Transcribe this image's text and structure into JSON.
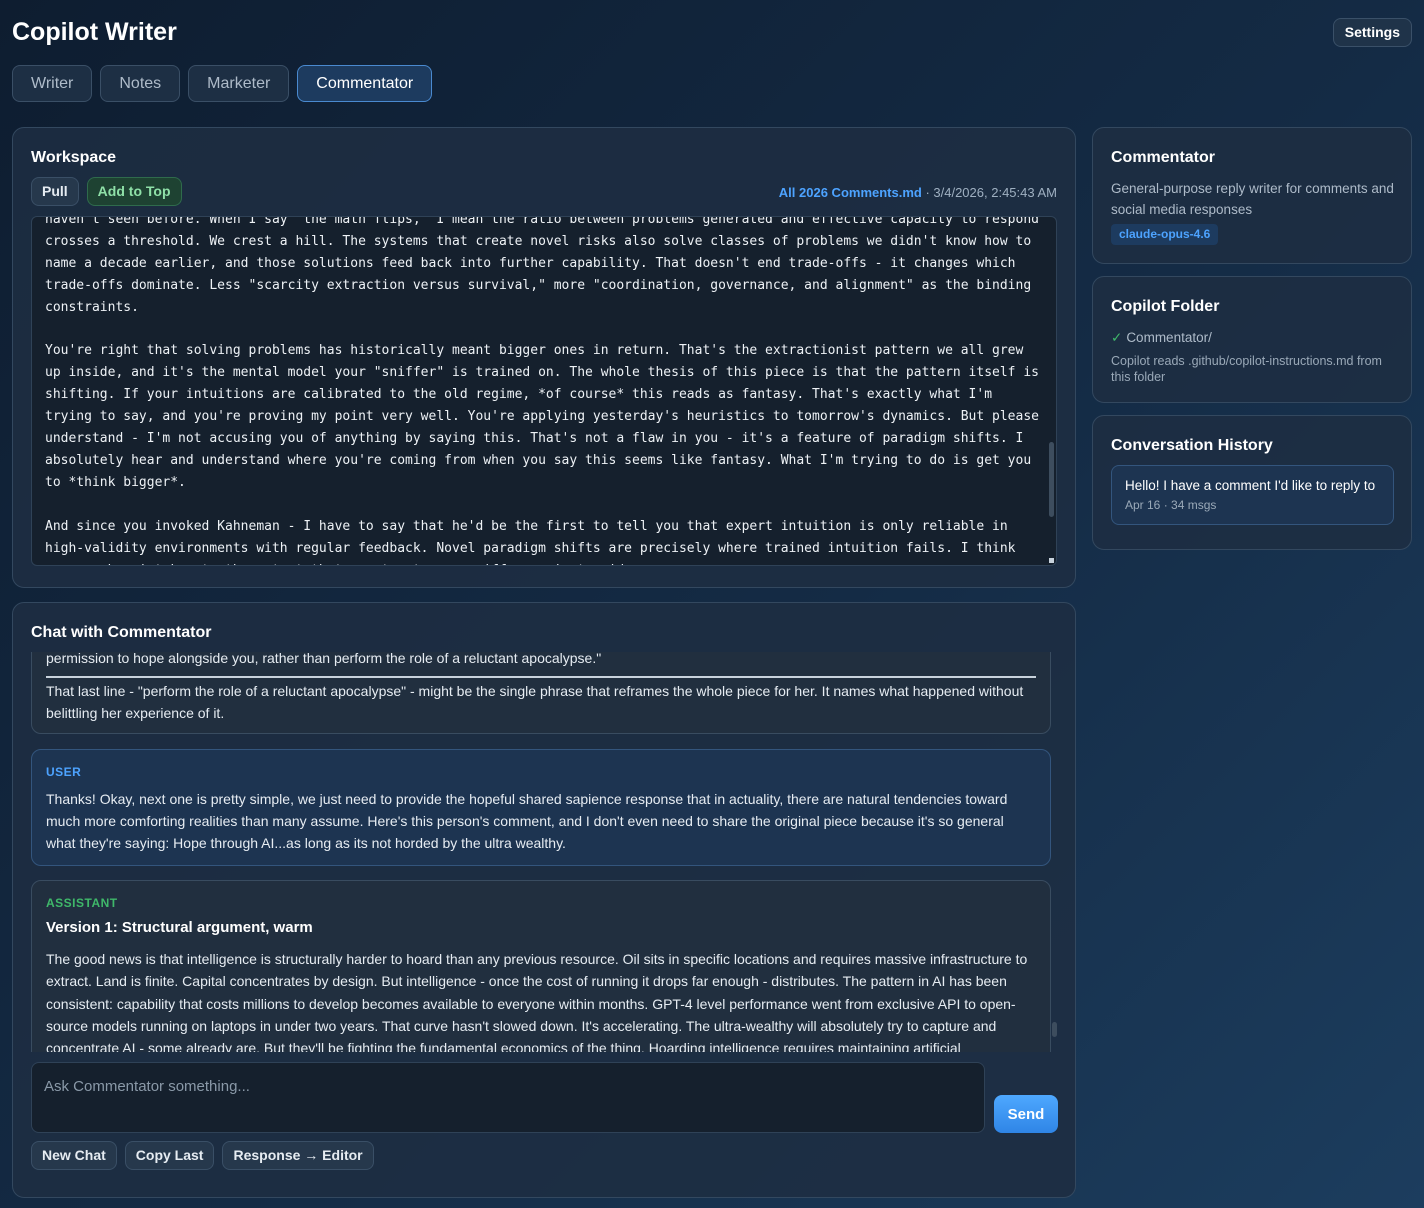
{
  "app": {
    "title": "Copilot Writer",
    "settings_label": "Settings"
  },
  "tabs": [
    {
      "label": "Writer",
      "active": false
    },
    {
      "label": "Notes",
      "active": false
    },
    {
      "label": "Marketer",
      "active": false
    },
    {
      "label": "Commentator",
      "active": true
    }
  ],
  "workspace": {
    "title": "Workspace",
    "pull_label": "Pull",
    "add_top_label": "Add to Top",
    "file_name": "All 2026 Comments.md",
    "file_meta": " · 3/4/2026, 2:45:43 AM",
    "content": "haven't seen before. When I say \"the math flips,\" I mean the ratio between problems generated and effective capacity to respond crosses a threshold. We crest a hill. The systems that create novel risks also solve classes of problems we didn't know how to name a decade earlier, and those solutions feed back into further capability. That doesn't end trade-offs - it changes which trade-offs dominate. Less \"scarcity extraction versus survival,\" more \"coordination, governance, and alignment\" as the binding constraints.\n\nYou're right that solving problems has historically meant bigger ones in return. That's the extractionist pattern we all grew up inside, and it's the mental model your \"sniffer\" is trained on. The whole thesis of this piece is that the pattern itself is shifting. If your intuitions are calibrated to the old regime, *of course* this reads as fantasy. That's exactly what I'm trying to say, and you're proving my point very well. You're applying yesterday's heuristics to tomorrow's dynamics. But please understand - I'm not accusing you of anything by saying this. That's not a flaw in you - it's a feature of paradigm shifts. I absolutely hear and understand where you're coming from when you say this seems like fantasy. What I'm trying to do is get you to *think bigger*.\n\nAnd since you invoked Kahneman - I have to say that he'd be the first to tell you that expert intuition is only reliable in high-validity environments with regular feedback. Novel paradigm shifts are precisely where trained intuition fails. I think you may be mistaken to the extent that you trust your sniffer against evidence."
  },
  "chat": {
    "title": "Chat with Commentator",
    "messages": {
      "prev_quote": "permission to hope alongside you, rather than perform the role of a reluctant apocalypse.\"",
      "prev_text": "That last line - \"perform the role of a reluctant apocalypse\" - might be the single phrase that reframes the whole piece for her. It names what happened without belittling her experience of it.",
      "user_role": "USER",
      "user_text": "Thanks! Okay, next one is pretty simple, we just need to provide the hopeful shared sapience response that in actuality, there are natural tendencies toward much more comforting realities than many assume. Here's this person's comment, and I don't even need to share the original piece because it's so general what they're saying: Hope through AI...as long as its not horded by the ultra wealthy.",
      "assistant_role": "ASSISTANT",
      "assistant_heading": "Version 1: Structural argument, warm",
      "assistant_text": "The good news is that intelligence is structurally harder to hoard than any previous resource. Oil sits in specific locations and requires massive infrastructure to extract. Land is finite. Capital concentrates by design. But intelligence - once the cost of running it drops far enough - distributes. The pattern in AI has been consistent: capability that costs millions to develop becomes available to everyone within months. GPT-4 level performance went from exclusive API to open-source models running on laptops in under two years. That curve hasn't slowed down. It's accelerating. The ultra-wealthy will absolutely try to capture and concentrate AI - some already are. But they'll be fighting the fundamental economics of the thing. Hoarding intelligence requires maintaining artificial"
    },
    "input_placeholder": "Ask Commentator something...",
    "send_label": "Send",
    "new_chat_label": "New Chat",
    "copy_last_label": "Copy Last",
    "response_editor_label": "Response → Editor"
  },
  "agent": {
    "title": "Commentator",
    "description": "General-purpose reply writer for comments and social media responses",
    "model": "claude-opus-4.6"
  },
  "folder": {
    "title": "Copilot Folder",
    "check_icon": "✓",
    "folder_name": "Commentator/",
    "note": "Copilot reads .github/copilot-instructions.md from this folder"
  },
  "history": {
    "title": "Conversation History",
    "items": [
      {
        "title": "Hello! I have a comment I'd like to reply to",
        "meta": "Apr 16 · 34 msgs"
      }
    ]
  },
  "colors": {
    "accent_blue": "#4da3ff",
    "accent_green": "#3fb86a",
    "panel_bg": "#1e2e42"
  }
}
